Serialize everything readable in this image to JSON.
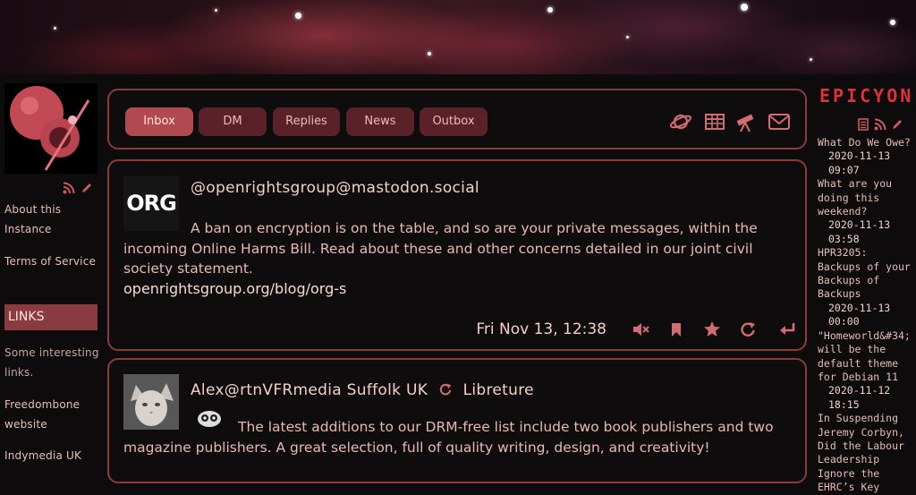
{
  "left": {
    "about": "About this Instance",
    "terms": "Terms of Service",
    "links_header": "LINKS",
    "links_intro": "Some interesting links.",
    "link1": "Freedombone website",
    "link2": "Indymedia UK"
  },
  "tabs": [
    {
      "label": "Inbox",
      "active": true
    },
    {
      "label": "DM",
      "active": false
    },
    {
      "label": "Replies",
      "active": false
    },
    {
      "label": "News",
      "active": false
    },
    {
      "label": "Outbox",
      "active": false
    }
  ],
  "top_icons": [
    "planet-icon",
    "calendar-grid-icon",
    "telescope-icon",
    "envelope-icon"
  ],
  "posts": [
    {
      "avatar_text": "ORG",
      "author": "@openrightsgroup@mastodon.social",
      "text": "A ban on encryption is on the table, and so are your private messages, within the incoming Online Harms Bill. Read about these and other concerns detailed in our joint civil society statement.",
      "link": "openrightsgroup.org/blog/org-s",
      "date": "Fri Nov 13, 12:38",
      "actions": [
        "mute-icon",
        "bookmark-icon",
        "star-icon",
        "repeat-icon",
        "reply-icon"
      ]
    },
    {
      "author": "Alex@rtnVFRmedia Suffolk UK",
      "repeated_by": "Libreture",
      "text": "The latest additions to our DRM-free list include two book publishers and two magazine publishers. A great selection, full of quality writing, design, and creativity!"
    }
  ],
  "right": {
    "brand": "EPICYON",
    "feed": [
      {
        "title": "What Do We Owe?",
        "date": "2020-11-13 09:07"
      },
      {
        "title": "What are you doing this weekend?",
        "date": "2020-11-13 03:58"
      },
      {
        "title": "HPR3205: Backups of your Backups of Backups",
        "date": "2020-11-13 00:00"
      },
      {
        "title": "\"Homeworld&#34; will be the default theme for Debian 11",
        "date": "2020-11-12 18:15"
      },
      {
        "title": "In Suspending Jeremy Corbyn, Did the Labour Leadership Ignore the EHRC’s Key",
        "date": ""
      }
    ]
  },
  "colors": {
    "accent": "#8a3b40",
    "tab": "#5a2228",
    "active_tab": "#b04a50",
    "brand": "#e0303a"
  }
}
